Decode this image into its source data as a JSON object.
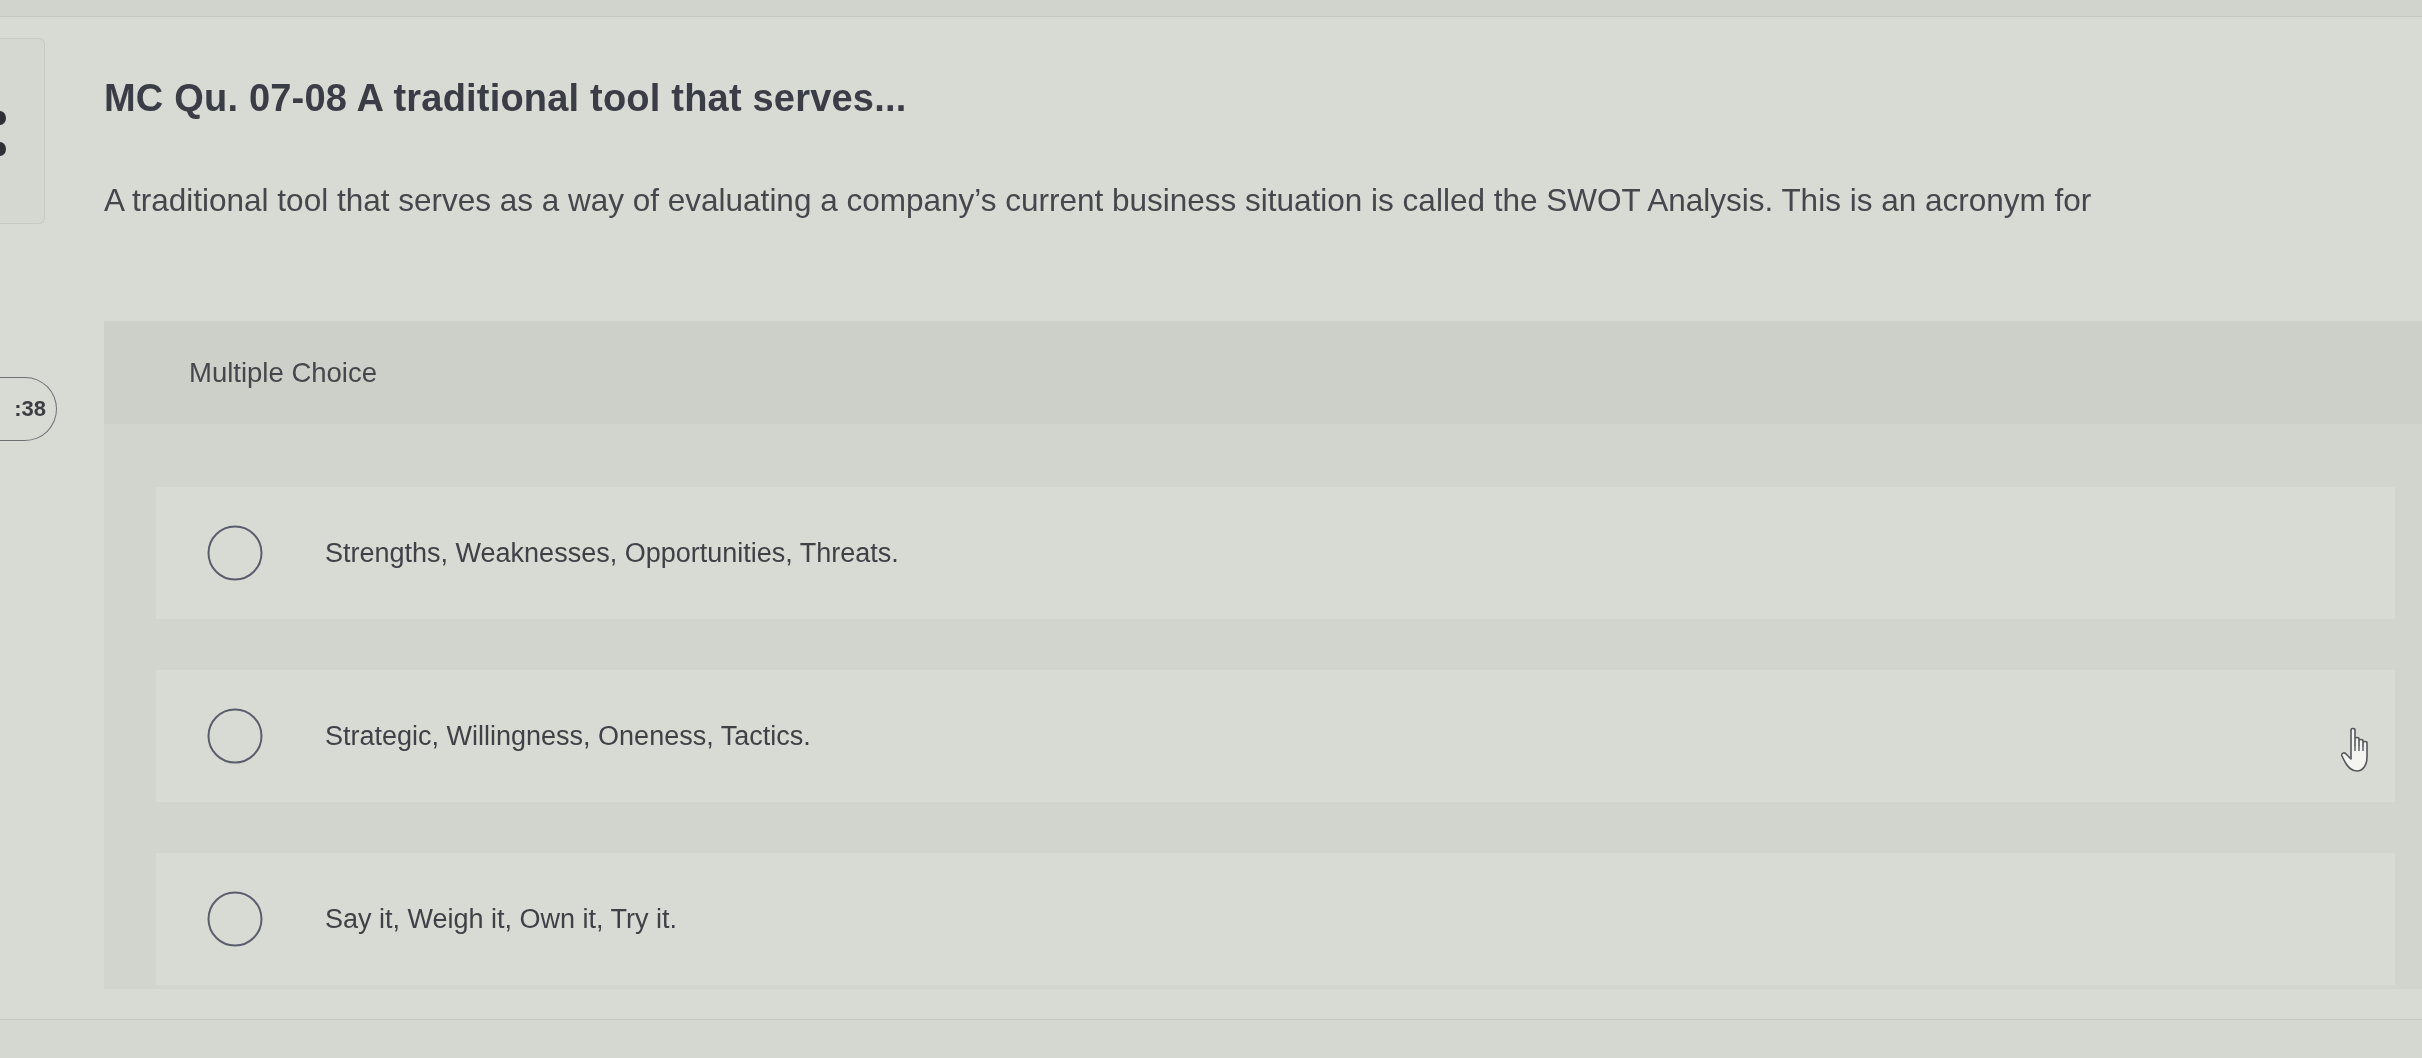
{
  "sidebar": {
    "timer": ":38"
  },
  "question": {
    "title": "MC Qu. 07-08 A traditional tool that serves...",
    "prompt": "A traditional tool that serves as a way of evaluating a company’s current business situation is called the SWOT Analysis. This is an acronym for"
  },
  "answer_panel": {
    "type_label": "Multiple Choice",
    "options": [
      {
        "label": "Strengths, Weaknesses, Opportunities, Threats.",
        "selected": false
      },
      {
        "label": "Strategic, Willingness, Oneness, Tactics.",
        "selected": false
      },
      {
        "label": "Say it, Weigh it, Own it, Try it.",
        "selected": false
      }
    ]
  }
}
